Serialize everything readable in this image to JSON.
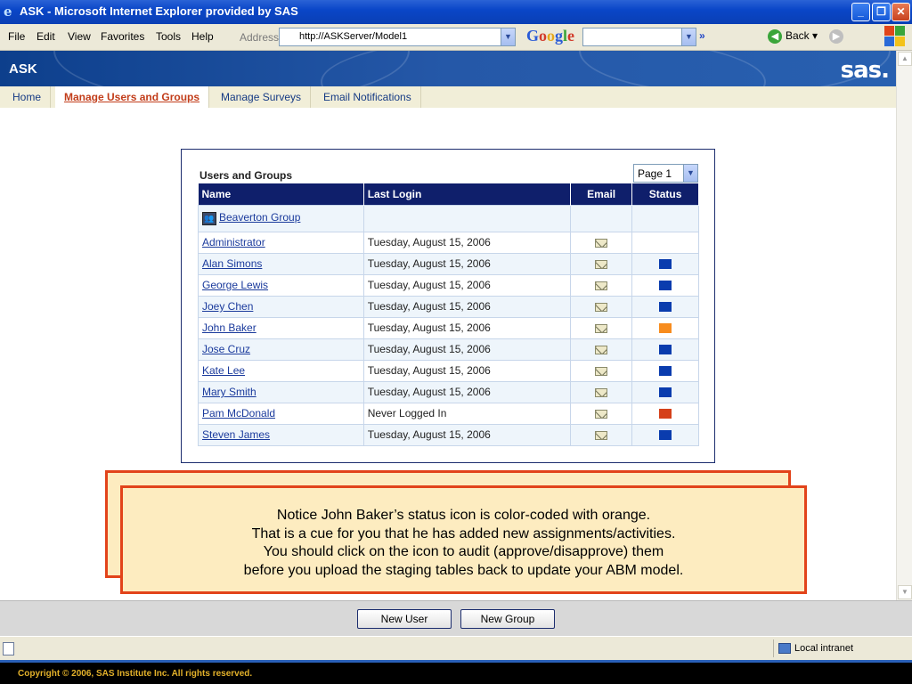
{
  "window": {
    "title": "ASK - Microsoft Internet Explorer provided by SAS",
    "controls": [
      "_",
      "❐",
      "✕"
    ]
  },
  "menubar": {
    "items": [
      "File",
      "Edit",
      "View",
      "Favorites",
      "Tools",
      "Help"
    ],
    "address_label": "Address",
    "address_value": "http://ASKServer/Model1",
    "search_engine": "Google",
    "back_label": "Back"
  },
  "banner": {
    "app_name": "ASK",
    "logo": "sas."
  },
  "tabs": [
    {
      "label": "Home",
      "active": false
    },
    {
      "label": "Manage Users and Groups",
      "active": true
    },
    {
      "label": "Manage Surveys",
      "active": false
    },
    {
      "label": "Email Notifications",
      "active": false
    }
  ],
  "panel": {
    "title": "Users and Groups",
    "page_select": "Page 1",
    "columns": [
      "Name",
      "Last Login",
      "Email",
      "Status"
    ],
    "group": {
      "name": "Beaverton Group"
    },
    "rows": [
      {
        "name": "Administrator",
        "last_login": "Tuesday, August 15, 2006",
        "email": true,
        "status_color": ""
      },
      {
        "name": "Alan Simons",
        "last_login": "Tuesday, August 15, 2006",
        "email": true,
        "status_color": "#0a3cae"
      },
      {
        "name": "George Lewis",
        "last_login": "Tuesday, August 15, 2006",
        "email": true,
        "status_color": "#0a3cae"
      },
      {
        "name": "Joey Chen",
        "last_login": "Tuesday, August 15, 2006",
        "email": true,
        "status_color": "#0a3cae"
      },
      {
        "name": "John Baker",
        "last_login": "Tuesday, August 15, 2006",
        "email": true,
        "status_color": "#f78c1e"
      },
      {
        "name": "Jose Cruz",
        "last_login": "Tuesday, August 15, 2006",
        "email": true,
        "status_color": "#0a3cae"
      },
      {
        "name": "Kate Lee",
        "last_login": "Tuesday, August 15, 2006",
        "email": true,
        "status_color": "#0a3cae"
      },
      {
        "name": "Mary Smith",
        "last_login": "Tuesday, August 15, 2006",
        "email": true,
        "status_color": "#0a3cae"
      },
      {
        "name": "Pam McDonald",
        "last_login": "Never Logged In",
        "email": true,
        "status_color": "#d5401a"
      },
      {
        "name": "Steven James",
        "last_login": "Tuesday, August 15, 2006",
        "email": true,
        "status_color": "#0a3cae"
      }
    ]
  },
  "callout": {
    "lines": [
      "Notice John Baker’s status icon is color-coded with orange.",
      "That is a cue for you that he has added new assignments/activities.",
      "You should click on the icon to audit (approve/disapprove) them",
      "before you upload the staging tables back to update your ABM model."
    ]
  },
  "buttons": {
    "new_user": "New User",
    "new_group": "New Group"
  },
  "statusbar": {
    "zone": "Local intranet"
  },
  "footer": {
    "copyright": "Copyright © 2006, SAS Institute Inc. All rights reserved."
  }
}
